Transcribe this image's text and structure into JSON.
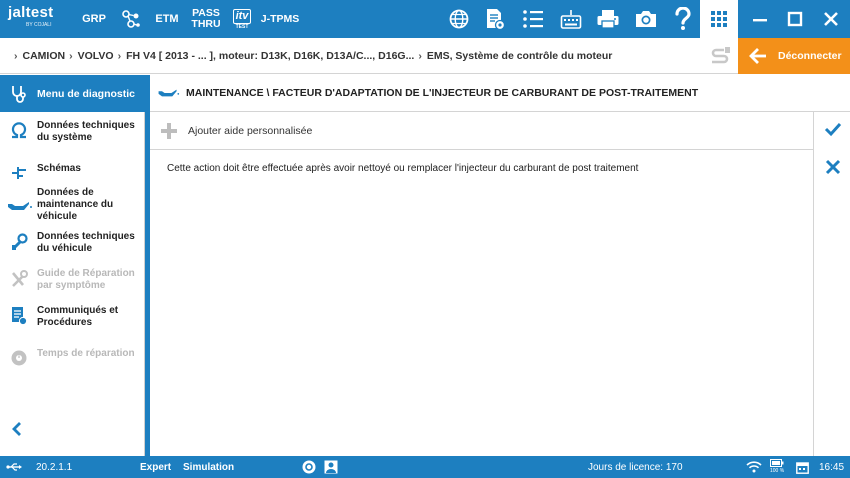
{
  "topbar": {
    "logo": "jaltest",
    "logo_sub": "BY COJALI",
    "buttons": {
      "grp": "GRP",
      "etm": "ETM",
      "pass": "PASS",
      "thru": "THRU",
      "itv": "itv",
      "itv_sub": "TEST",
      "tpms": "J-TPMS"
    },
    "icons": [
      "molecule-icon",
      "globe-icon",
      "document-gear-icon",
      "list-icon",
      "keyboard-icon",
      "printer-icon",
      "camera-icon",
      "help-icon",
      "grid-icon",
      "minimize-icon",
      "maximize-icon",
      "close-icon"
    ]
  },
  "breadcrumb": {
    "items": [
      "CAMION",
      "VOLVO",
      "FH V4 [ 2013 - ... ], moteur: D13K, D16K, D13A/C..., D16G...",
      "EMS, Système de contrôle du moteur"
    ]
  },
  "disconnect_label": "Déconnecter",
  "sidebar": {
    "title": "Menu de diagnostic",
    "items": [
      {
        "label": "Données techniques du système",
        "icon": "omega-icon",
        "enabled": true
      },
      {
        "label": "Schémas",
        "icon": "schematic-icon",
        "enabled": true
      },
      {
        "label": "Données de maintenance du véhicule",
        "icon": "oil-can-icon",
        "enabled": true
      },
      {
        "label": "Données techniques du véhicule",
        "icon": "wrench-icon",
        "enabled": true
      },
      {
        "label": "Guide de Réparation par symptôme",
        "icon": "tools-icon",
        "enabled": false
      },
      {
        "label": "Communiqués et Procédures",
        "icon": "bulletin-icon",
        "enabled": true
      },
      {
        "label": "Temps de réparation",
        "icon": "clock-gear-icon",
        "enabled": false
      }
    ]
  },
  "content": {
    "title": "MAINTENANCE \\ FACTEUR D'ADAPTATION DE L'INJECTEUR DE CARBURANT DE POST-TRAITEMENT",
    "add_help": "Ajouter aide personnalisée",
    "body": "Cette action doit être effectuée après avoir nettoyé ou remplacer l'injecteur du carburant de post traitement"
  },
  "status": {
    "version": "20.2.1.1",
    "mode": "Expert",
    "simulation": "Simulation",
    "license": "Jours de licence: 170",
    "battery": "100 %",
    "time": "16:45"
  },
  "colors": {
    "primary": "#1d7fc0",
    "accent": "#f39019"
  }
}
